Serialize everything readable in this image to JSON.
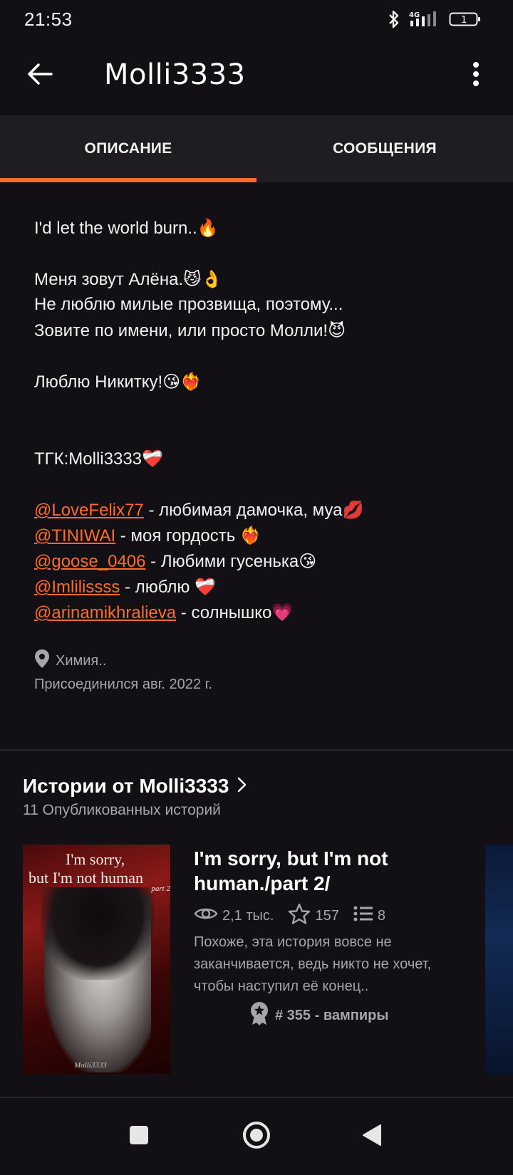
{
  "status_bar": {
    "time": "21:53",
    "network": "4G",
    "battery": "1"
  },
  "app_bar": {
    "title": "Molli3333",
    "back_icon": "arrow-left-icon",
    "more_icon": "more-vertical-icon"
  },
  "tabs": [
    {
      "label": "ОПИСАНИЕ",
      "active": true
    },
    {
      "label": "СООБЩЕНИЯ",
      "active": false
    }
  ],
  "bio": {
    "line1": "I'd let the world burn..",
    "line1_emoji": "🔥",
    "line2": "Меня зовут Алёна.",
    "line2_emoji": "😼👌",
    "line3": "Не люблю милые прозвища, поэтому...",
    "line4": "Зовите по имени, или просто Молли!",
    "line4_emoji": "😈",
    "line5": "Люблю Никитку!",
    "line5_emoji": "😘❤️‍🔥",
    "line6": "ТГК:Molli3333",
    "line6_emoji": "❤️‍🩹",
    "mentions": [
      {
        "handle": "@LoveFelix77",
        "text": " - любимая дамочка, муа",
        "emoji": "💋"
      },
      {
        "handle": "@TINIWAI",
        "text": " - моя гордость ",
        "emoji": "❤️‍🔥"
      },
      {
        "handle": "@goose_0406",
        "text": " - Любими гусенька",
        "emoji": "😘"
      },
      {
        "handle": "@Imlilissss",
        "text": " - люблю ",
        "emoji": "❤️‍🩹"
      },
      {
        "handle": "@arinamikhralieva",
        "text": " - солнышко",
        "emoji": "💗"
      }
    ]
  },
  "meta": {
    "location": "Химия..",
    "joined": "Присоединился авг. 2022 г."
  },
  "stories": {
    "title": "Истории от Molli3333",
    "count": "11 Опубликованных историй",
    "items": [
      {
        "cover_line1": "I'm sorry,",
        "cover_line2": "but I'm not human",
        "cover_line3": "part 2",
        "cover_author": "Molli3333",
        "title": "I'm sorry, but I'm not human./part 2/",
        "reads": "2,1 тыс.",
        "votes": "157",
        "parts": "8",
        "description": "Похоже, эта история вовсе не заканчивается, ведь никто не хочет, чтобы наступил её конец..",
        "rank": "# 355 - вампиры"
      }
    ]
  },
  "colors": {
    "accent": "#ff6a2b",
    "background": "#121014",
    "tab_background": "#1f1d21",
    "secondary_text": "#a7a4ab"
  }
}
